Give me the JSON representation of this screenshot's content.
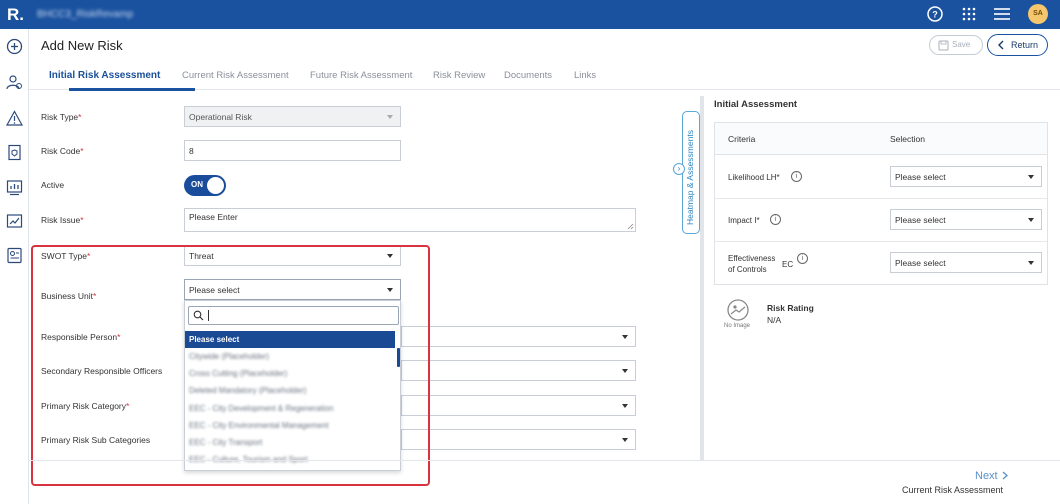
{
  "topbar": {
    "logo": "R.",
    "app_title": "BHCC3_RiskRevamp",
    "avatar_initials": "SA"
  },
  "page": {
    "title": "Add New Risk",
    "save_label": "Save",
    "return_label": "Return"
  },
  "tabs": [
    {
      "label": "Initial Risk Assessment"
    },
    {
      "label": "Current Risk Assessment"
    },
    {
      "label": "Future Risk Assessment"
    },
    {
      "label": "Risk Review"
    },
    {
      "label": "Documents"
    },
    {
      "label": "Links"
    }
  ],
  "form": {
    "risk_type": {
      "label": "Risk Type",
      "value": "Operational Risk"
    },
    "risk_code": {
      "label": "Risk Code",
      "value": "8"
    },
    "active": {
      "label": "Active",
      "value": "ON"
    },
    "risk_issue": {
      "label": "Risk Issue",
      "placeholder": "Please Enter"
    },
    "swot_type": {
      "label": "SWOT Type",
      "value": "Threat"
    },
    "business_unit": {
      "label": "Business Unit",
      "value": "Please select"
    },
    "responsible_person": {
      "label": "Responsible Person"
    },
    "secondary_officers": {
      "label": "Secondary Responsible Officers"
    },
    "primary_category": {
      "label": "Primary Risk Category"
    },
    "primary_sub_categories": {
      "label": "Primary Risk Sub Categories"
    },
    "required_mark": "*"
  },
  "dropdown": {
    "options": [
      "Please select",
      "Citywide (Placeholder)",
      "Cross Cutting (Placeholder)",
      "Deleted Mandatory (Placeholder)",
      "EEC - City Development & Regeneration",
      "EEC - City Environmental Management",
      "EEC - City Transport",
      "EEC - Culture, Tourism and Sport"
    ]
  },
  "heatmap_tab": "Heatmap & Assessments",
  "assessment": {
    "title": "Initial Assessment",
    "col_criteria": "Criteria",
    "col_selection": "Selection",
    "rows": [
      {
        "criteria": "Likelihood",
        "code": "LH",
        "required": "*",
        "value": "Please select"
      },
      {
        "criteria": "Impact",
        "code": "I",
        "required": "*",
        "value": "Please select"
      },
      {
        "criteria_line1": "Effectiveness",
        "criteria_line2": "of Controls",
        "code": "EC",
        "value": "Please select"
      }
    ],
    "no_image": "No Image",
    "risk_rating_label": "Risk Rating",
    "risk_rating_value": "N/A"
  },
  "footer": {
    "next_label": "Next",
    "next_sub": "Current Risk Assessment"
  },
  "colors": {
    "brand": "#1a52a0",
    "highlight_box": "#d9333f",
    "selected_option": "#1a4a93"
  }
}
